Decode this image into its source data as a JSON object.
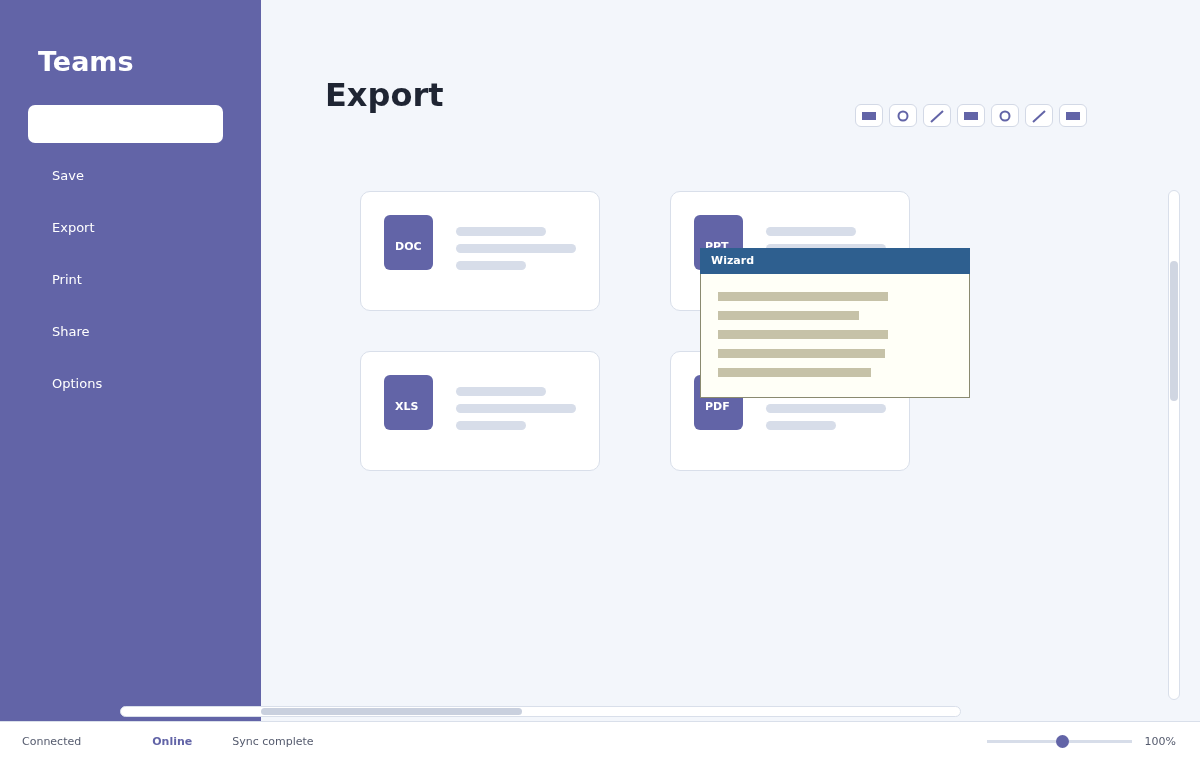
{
  "sidebar": {
    "title": "Teams",
    "items": [
      {
        "label": "Save",
        "selected": false
      },
      {
        "label": "Export",
        "selected": false
      },
      {
        "label": "Print",
        "selected": false
      },
      {
        "label": "Share",
        "selected": false
      },
      {
        "label": "Options",
        "selected": false
      }
    ]
  },
  "page": {
    "title": "Export"
  },
  "toolbar": [
    {
      "kind": "rect"
    },
    {
      "kind": "circle"
    },
    {
      "kind": "line"
    },
    {
      "kind": "rect"
    },
    {
      "kind": "circle"
    },
    {
      "kind": "line"
    },
    {
      "kind": "rect"
    }
  ],
  "cards": [
    {
      "label": "DOC"
    },
    {
      "label": "PPT"
    },
    {
      "label": "XLS"
    },
    {
      "label": "PDF"
    }
  ],
  "popup": {
    "title": "Wizard"
  },
  "status_bar": {
    "items": [
      {
        "text": "Connected",
        "kind": "plain"
      },
      {
        "text": "Online",
        "kind": "strong"
      },
      {
        "text": "Sync complete",
        "kind": "plain"
      }
    ],
    "zoom": {
      "level": 0.52,
      "reading": "100%"
    }
  }
}
